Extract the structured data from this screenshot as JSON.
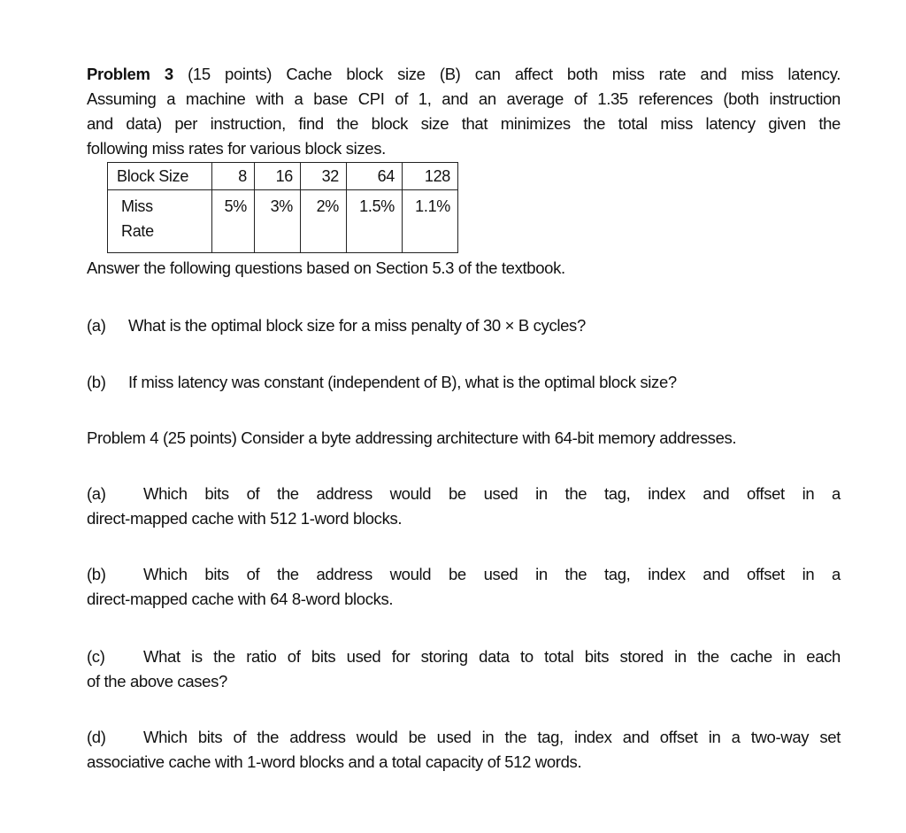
{
  "problem3": {
    "title_bold": "Problem 3",
    "intro_lines": [
      " (15 points) Cache block size (B) can affect both miss rate and miss latency.",
      "Assuming a machine with a base CPI of 1, and an average of 1.35 references (both instruction",
      "and data) per instruction, find the block size that minimizes the total miss latency given the",
      "following miss rates for various block sizes."
    ],
    "table": {
      "row_headers": [
        "Block Size",
        "Miss",
        "Rate"
      ],
      "block_sizes": [
        "8",
        "16",
        "32",
        "64",
        "128"
      ],
      "miss_rates": [
        "5%",
        "3%",
        "2%",
        "1.5%",
        "1.1%"
      ]
    },
    "answer_note": "Answer the following questions based on Section 5.3 of the textbook.",
    "questions": [
      {
        "label": "(a)",
        "text": "What is the optimal block size for a miss penalty of 30 × B cycles?"
      },
      {
        "label": "(b)",
        "text": "If miss latency was constant (independent of B), what is the optimal block size?"
      }
    ]
  },
  "problem4": {
    "intro": "Problem 4 (25 points) Consider a byte addressing architecture with 64-bit memory addresses.",
    "questions": [
      {
        "label": "(a)",
        "line1": "Which bits of the address would be used in the tag, index and offset in a",
        "line2": "direct-mapped cache with 512 1-word blocks."
      },
      {
        "label": "(b)",
        "line1": "Which bits of the address would be used in the tag, index and offset in a",
        "line2": "direct-mapped cache with 64 8-word blocks."
      },
      {
        "label": "(c)",
        "line1": "What is the ratio of bits used for storing data to total bits stored in the cache in each",
        "line2": "of the above cases?"
      },
      {
        "label": "(d)",
        "line1": "Which bits of the address would be used in the tag, index and offset in a two-way set",
        "line2": "associative cache with 1-word blocks and a total capacity of 512 words."
      }
    ]
  }
}
